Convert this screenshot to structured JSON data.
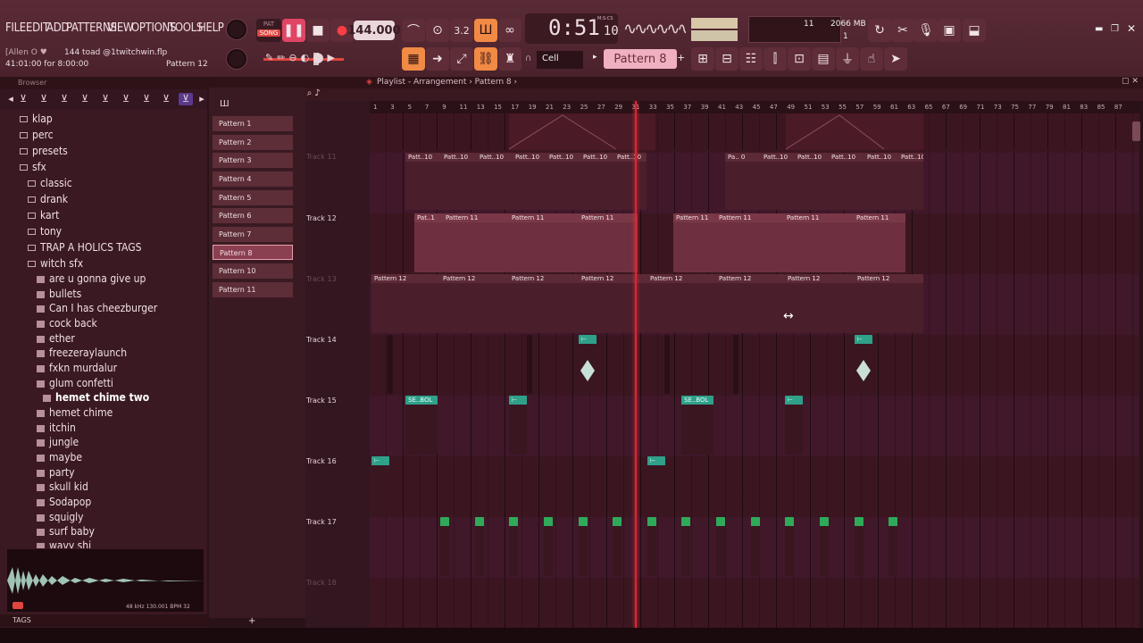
{
  "menu": [
    "FILE",
    "EDIT",
    "ADD",
    "PATTERNS",
    "VIEW",
    "OPTIONS",
    "TOOLS",
    "HELP"
  ],
  "song_mode": {
    "pat": "PAT",
    "song": "SONG"
  },
  "tempo": "144.000",
  "time": {
    "main": "0:51",
    "sub": "10",
    "label": "M:S:CS"
  },
  "cpu": {
    "value": "11",
    "memory": "2066 MB",
    "voices": "1"
  },
  "project": {
    "user": "[Allen O ♥",
    "title": "144 toad @1twitchwin.flp",
    "position": "41:01:00 for 8:00:00",
    "pattern": "Pattern 12"
  },
  "snap": "Cell",
  "selected_pattern": "Pattern 8",
  "browser": {
    "title": "Browser",
    "folders": [
      "klap",
      "perc",
      "presets",
      "sfx",
      "classic",
      "drank",
      "kart",
      "tony",
      "TRAP A HOLICS TAGS",
      "witch sfx"
    ],
    "files": [
      "are u gonna give up",
      "bullets",
      "Can I has cheezburger",
      "cock back",
      "ether",
      "freezeraylaunch",
      "fxkn murdalur",
      "glum confetti",
      "hemet chime two",
      "hemet chime",
      "itchin",
      "jungle",
      "maybe",
      "party",
      "skull kid",
      "Sodapop",
      "squigly",
      "surf baby",
      "wavy shi"
    ],
    "sample_info": "48 kHz 130.001 BPM 32",
    "tags": "TAGS"
  },
  "patterns": [
    "Pattern 1",
    "Pattern 2",
    "Pattern 3",
    "Pattern 4",
    "Pattern 5",
    "Pattern 6",
    "Pattern 7",
    "Pattern 8",
    "Pattern 10",
    "Pattern 11"
  ],
  "playlist": {
    "breadcrumb": "Playlist - Arrangement › Pattern 8 ›",
    "ruler": [
      "1",
      "3",
      "5",
      "7",
      "9",
      "11",
      "13",
      "15",
      "17",
      "19",
      "21",
      "23",
      "25",
      "27",
      "29",
      "31",
      "33",
      "35",
      "37",
      "39",
      "41",
      "43",
      "45",
      "47",
      "49",
      "51",
      "53",
      "55",
      "57",
      "59",
      "61",
      "63",
      "65",
      "67",
      "69",
      "71",
      "73",
      "75",
      "77",
      "79",
      "81",
      "83",
      "85",
      "87"
    ],
    "tracks": [
      {
        "name": "Track 11",
        "dim": true
      },
      {
        "name": "Track 12",
        "dim": false
      },
      {
        "name": "Track 13",
        "dim": true
      },
      {
        "name": "Track 14",
        "dim": false
      },
      {
        "name": "Track 15",
        "dim": false
      },
      {
        "name": "Track 16",
        "dim": false
      },
      {
        "name": "Track 17",
        "dim": false
      },
      {
        "name": "Track 18",
        "dim": true
      }
    ],
    "clip_labels": {
      "patt10": "Patt..10",
      "pa0": "Pa.. 0",
      "pat11": "Pattern 11",
      "pat1": "Pat..1",
      "pat12": "Pattern 12",
      "sebol": "SE..BOL"
    }
  },
  "colors": {
    "accent": "#f08a45",
    "playhead": "#e0242e",
    "record": "#e0453f",
    "pattern_selector": "#f0b0c0"
  }
}
